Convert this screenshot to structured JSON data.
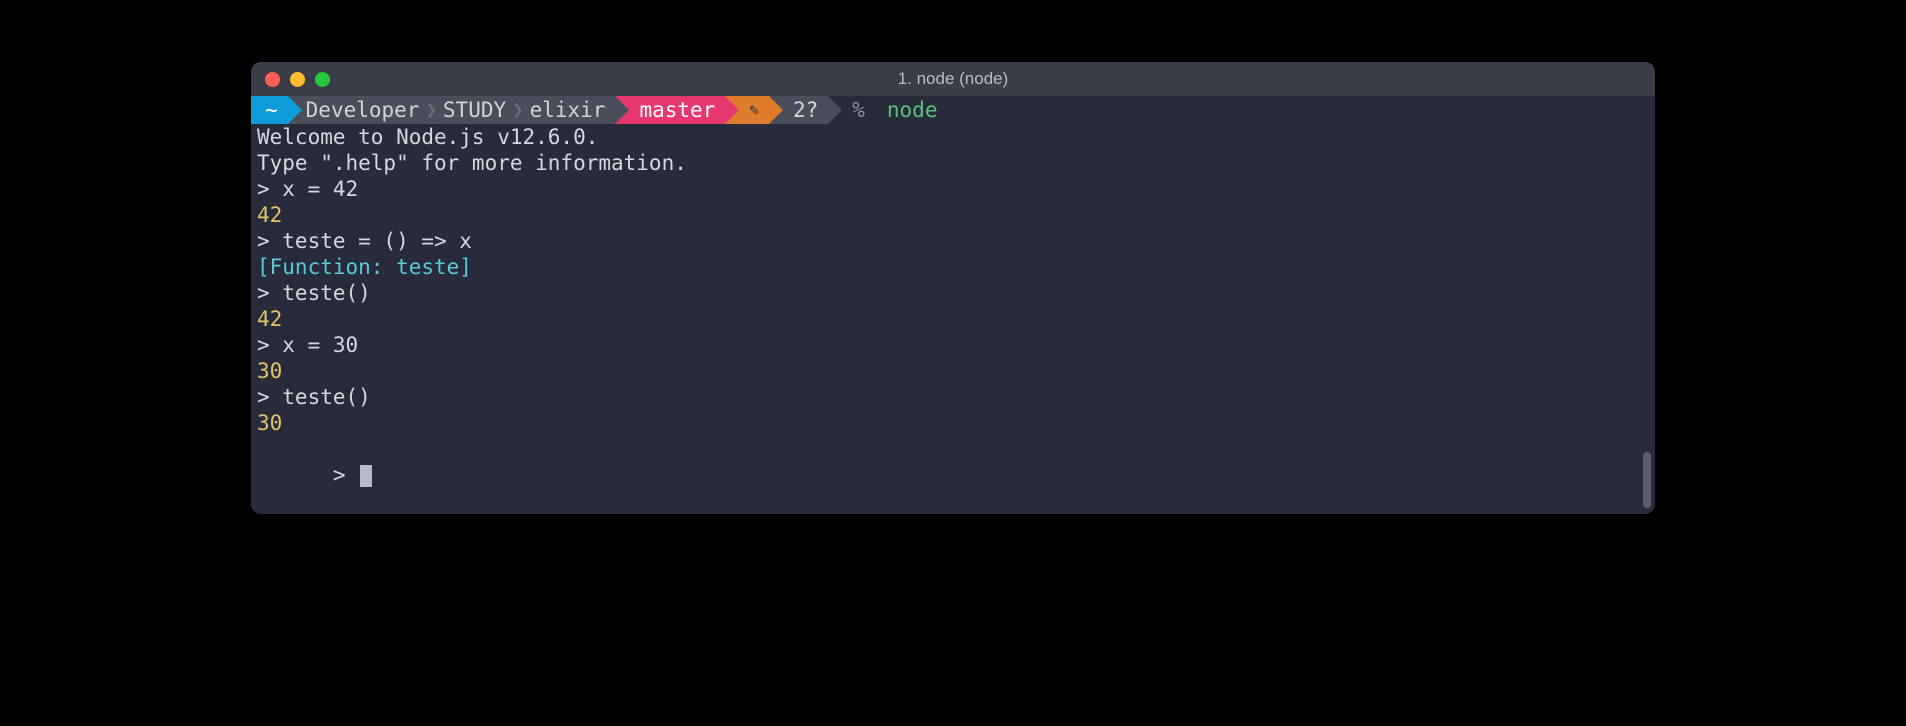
{
  "window": {
    "title": "1. node (node)"
  },
  "prompt": {
    "home": "~",
    "path1": "Developer",
    "path2": "STUDY",
    "path3": "elixir",
    "branch": "master",
    "unstaged_icon": "✎",
    "untracked": "2?",
    "end_sym": "%",
    "command": "node"
  },
  "lines": {
    "welcome": "Welcome to Node.js v12.6.0.",
    "help": "Type \".help\" for more information.",
    "p1": "> x = 42",
    "r1": "42",
    "p2": "> teste = () => x",
    "r2": "[Function: teste]",
    "p3": "> teste()",
    "r3": "42",
    "p4": "> x = 30",
    "r4": "30",
    "p5": "> teste()",
    "r5": "30",
    "p6": "> "
  }
}
